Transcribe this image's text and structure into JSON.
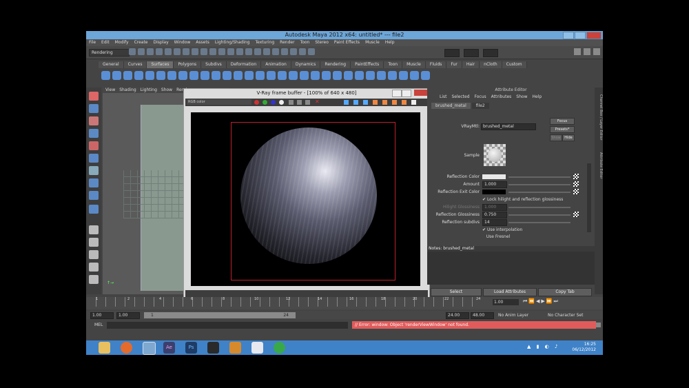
{
  "app": {
    "title": "Autodesk Maya 2012 x64: untitled*   ---   file2"
  },
  "menubar": [
    "File",
    "Edit",
    "Modify",
    "Create",
    "Display",
    "Window",
    "Assets",
    "Lighting/Shading",
    "Texturing",
    "Render",
    "Toon",
    "Stereo",
    "Paint Effects",
    "Muscle",
    "Help"
  ],
  "status_line": {
    "mode": "Rendering"
  },
  "shelf": {
    "tabs": [
      "General",
      "Curves",
      "Surfaces",
      "Polygons",
      "Subdivs",
      "Deformation",
      "Animation",
      "Dynamics",
      "Rendering",
      "PaintEffects",
      "Toon",
      "Muscle",
      "Fluids",
      "Fur",
      "Hair",
      "nCloth",
      "Custom"
    ],
    "active_tab": "Surfaces"
  },
  "viewport": {
    "menu": [
      "View",
      "Shading",
      "Lighting",
      "Show",
      "Rend"
    ]
  },
  "vray": {
    "title": "V-Ray frame buffer - [100% of 640 x 480]",
    "channel": "RGB color"
  },
  "attribute_editor": {
    "header": "Attribute Editor",
    "menu": [
      "List",
      "Selected",
      "Focus",
      "Attributes",
      "Show",
      "Help"
    ],
    "tabs": [
      "brushed_metal",
      "file2"
    ],
    "active_tab": "brushed_metal",
    "material_label": "VRayMtl:",
    "material_value": "brushed_metal",
    "focus_label": "Focus",
    "presets_label": "Presets*",
    "show_label": "Show",
    "hide_label": "Hide",
    "sample_label": "Sample",
    "rows": [
      {
        "label": "Reflection Color",
        "value": ""
      },
      {
        "label": "Amount",
        "value": "1.000"
      },
      {
        "label": "Reflection Exit Color",
        "value": ""
      },
      {
        "label": "",
        "value": "Lock hilight and reflection glossiness",
        "checkbox": true
      },
      {
        "label": "Hilight Glossiness",
        "value": "1.000"
      },
      {
        "label": "Reflection Glossiness",
        "value": "0.750"
      },
      {
        "label": "Reflection subdivs",
        "value": "14"
      },
      {
        "label": "",
        "value": "Use interpolation",
        "checkbox": true
      },
      {
        "label": "",
        "value": "Use Fresnel",
        "checkbox": false
      }
    ],
    "notes_label": "Notes: brushed_metal",
    "buttons": [
      "Select",
      "Load Attributes",
      "Copy Tab"
    ]
  },
  "right_strip": [
    "Channel Box / Layer Editor",
    "Attribute Editor"
  ],
  "timeline": {
    "ticks": [
      "1",
      "2",
      "4",
      "6",
      "8",
      "10",
      "12",
      "14",
      "16",
      "18",
      "20",
      "22",
      "24"
    ],
    "current_frame": "1.00"
  },
  "range": {
    "start": "1.00",
    "start2": "1.00",
    "slider_start": "1",
    "slider_end": "24",
    "end": "24.00",
    "end2": "48.00",
    "anim_layer": "No Anim Layer",
    "char_set": "No Character Set"
  },
  "mel": {
    "label": "MEL",
    "error": "// Error: window: Object 'renderViewWindow' not found."
  },
  "taskbar": {
    "time": "16:25",
    "date": "06/12/2012"
  },
  "colors": {
    "accent": "#6da6d8",
    "error": "#e05b5b",
    "taskbar": "#3f82c8"
  }
}
